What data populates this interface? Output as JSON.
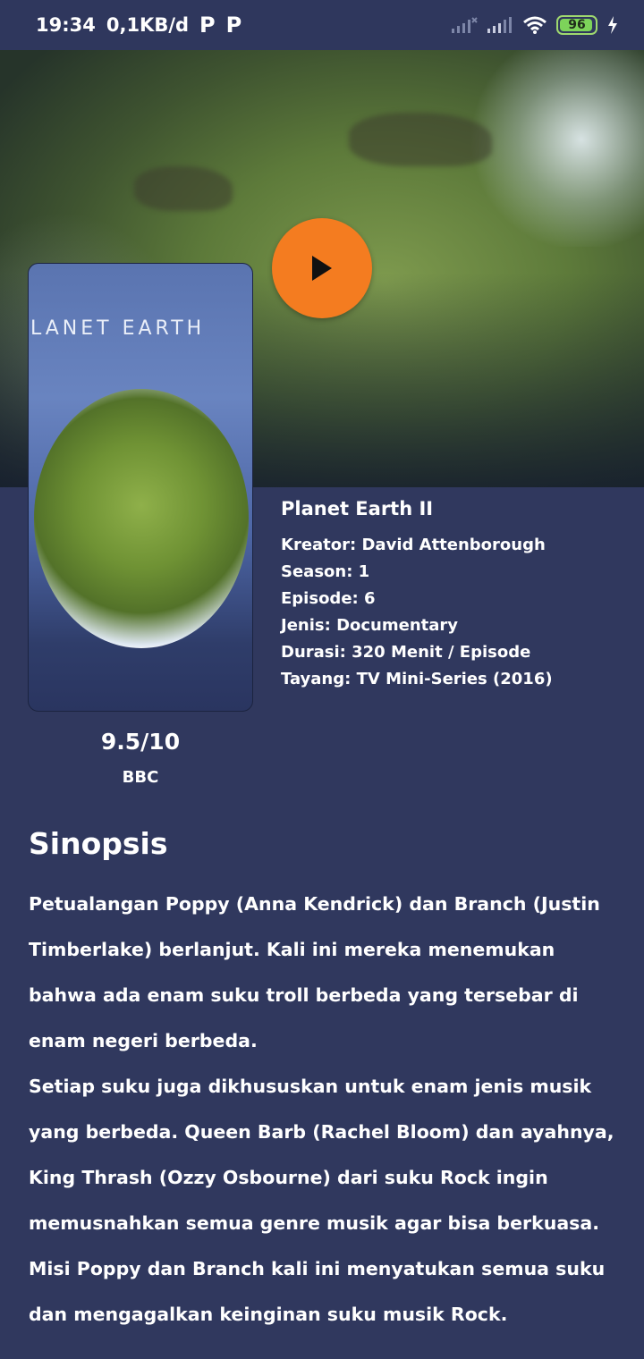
{
  "status_bar": {
    "time": "19:34",
    "speed": "0,1KB/d",
    "app_icons": [
      "P",
      "P"
    ],
    "battery": "96"
  },
  "poster": {
    "title_text": "LANET EARTH"
  },
  "colors": {
    "background": "#30385e",
    "play_button": "#f47c20",
    "battery": "#7dd35a"
  },
  "details": {
    "title": "Planet Earth II",
    "creator": "Kreator: David Attenborough",
    "season": "Season: 1",
    "episode": "Episode: 6",
    "genre": "Jenis: Documentary",
    "duration": "Durasi: 320 Menit / Episode",
    "aired": "Tayang: TV Mini-Series (2016)"
  },
  "rating": "9.5/10",
  "network": "BBC",
  "synopsis": {
    "heading": "Sinopsis",
    "paragraphs": [
      "Petualangan Poppy (Anna Kendrick) dan Branch (Justin Timberlake) berlanjut. Kali ini mereka menemukan bahwa ada enam suku troll berbeda yang tersebar di enam negeri berbeda.",
      "Setiap suku juga dikhususkan untuk enam jenis musik yang berbeda. Queen Barb (Rachel Bloom) dan ayahnya, King Thrash (Ozzy Osbourne) dari suku Rock ingin memusnahkan semua genre musik agar bisa berkuasa. Misi Poppy dan Branch kali ini menyatukan semua suku dan mengagalkan keinginan suku musik Rock."
    ]
  }
}
